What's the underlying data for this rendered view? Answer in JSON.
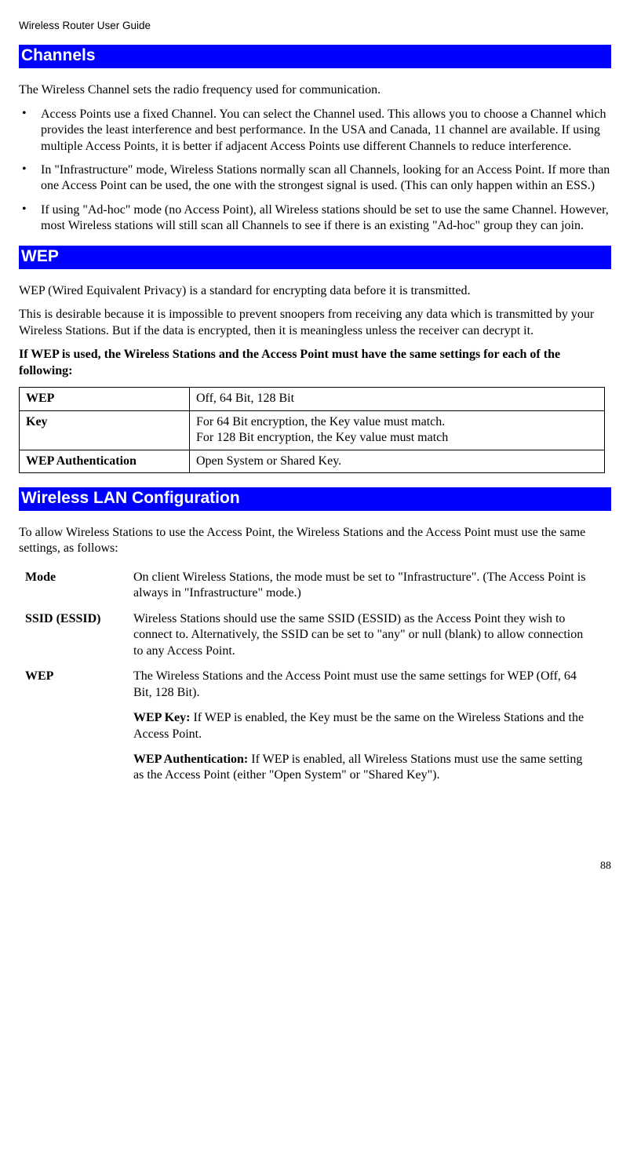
{
  "doc_title": "Wireless Router User Guide",
  "sec_channels_title": "Channels",
  "channels_intro": "The Wireless Channel sets the radio frequency used for communication.",
  "channels_bullets": [
    "Access Points use a fixed Channel. You can select the Channel used. This allows you to choose a Channel which provides the least interference and best performance. In the USA and Canada, 11 channel are available. If using multiple Access Points, it is better if adjacent Access Points use different Channels to reduce interference.",
    "In \"Infrastructure\" mode, Wireless Stations normally scan all Channels, looking for an Access Point. If more than one Access Point can be used, the one with the strongest signal is used. (This can only happen within an ESS.)",
    "If using \"Ad-hoc\" mode (no Access Point), all Wireless stations should be set to use the same Channel. However, most Wireless stations will still scan all Channels to see if there is an existing \"Ad-hoc\" group they can join."
  ],
  "sec_wep_title": "WEP",
  "wep_p1": "WEP (Wired Equivalent Privacy) is a standard for encrypting data before it is transmitted.",
  "wep_p2": "This is desirable because it is impossible to prevent snoopers from receiving any data which is transmitted by your Wireless Stations. But if the data is encrypted, then it is meaningless unless the receiver can decrypt it.",
  "wep_p3_bold": "If WEP is used, the Wireless Stations and the Access Point must have the same settings for each of the following:",
  "wep_table": {
    "r1": {
      "h": "WEP",
      "v": "Off, 64 Bit, 128 Bit"
    },
    "r2": {
      "h": "Key",
      "v1": "For 64 Bit encryption, the Key value must match.",
      "v2": "For 128 Bit encryption, the Key value must match"
    },
    "r3": {
      "h": "WEP Authentication",
      "v": "Open System or Shared Key."
    }
  },
  "sec_wlan_title": "Wireless LAN Configuration",
  "wlan_intro": "To allow Wireless Stations to use the Access Point, the Wireless Stations and the Access Point must use the same settings, as follows:",
  "wlan_defs": {
    "mode_term": "Mode",
    "mode_val": "On client Wireless Stations, the mode must be set to \"Infrastructure\". (The Access Point is always in \"Infrastructure\" mode.)",
    "ssid_term": "SSID (ESSID)",
    "ssid_val": "Wireless Stations should use the same SSID (ESSID) as the Access Point they wish to connect to. Alternatively, the SSID can be set to \"any\" or null (blank) to allow connection to any Access Point.",
    "wep_term": "WEP",
    "wep_v1": "The Wireless Stations and the Access Point must use the same settings for WEP (Off, 64 Bit, 128 Bit).",
    "wep_v2_b": "WEP Key:  ",
    "wep_v2": "If WEP is enabled, the Key must be the same on the Wireless Stations and the Access Point.",
    "wep_v3_b": "WEP Authentication:  ",
    "wep_v3": "If WEP is enabled, all Wireless Stations must use the same setting as the Access Point (either \"Open System\" or \"Shared Key\")."
  },
  "page_number": "88"
}
